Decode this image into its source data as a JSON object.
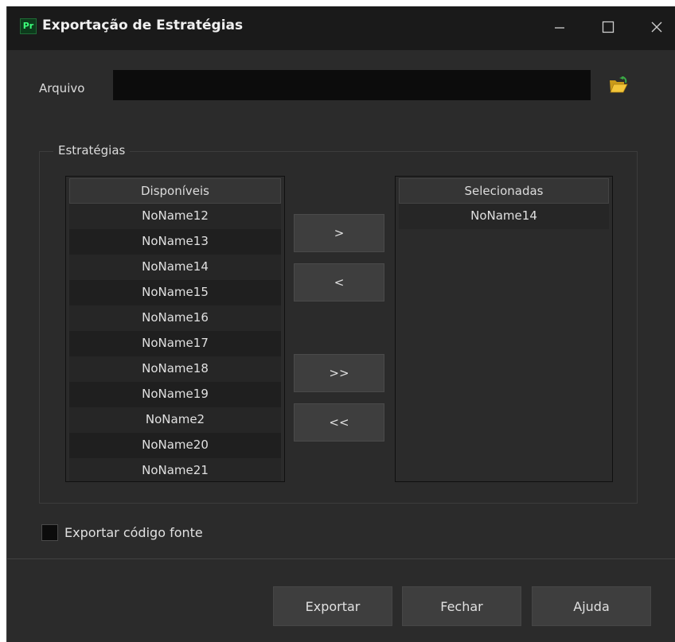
{
  "window": {
    "app_icon_text": "Pr",
    "title": "Exportação de Estratégias",
    "controls": {
      "minimize_icon": "minimize-icon",
      "maximize_icon": "maximize-icon",
      "close_icon": "close-icon"
    }
  },
  "arquivo": {
    "label": "Arquivo",
    "value": "",
    "placeholder": "",
    "browse_icon": "open-folder-icon"
  },
  "estrategias": {
    "group_title": "Estratégias",
    "disponiveis": {
      "header": "Disponíveis",
      "items": [
        "NoName12",
        "NoName13",
        "NoName14",
        "NoName15",
        "NoName16",
        "NoName17",
        "NoName18",
        "NoName19",
        "NoName2",
        "NoName20",
        "NoName21"
      ]
    },
    "selecionadas": {
      "header": "Selecionadas",
      "items": [
        "NoName14"
      ]
    },
    "buttons": {
      "add_one": ">",
      "remove_one": "<",
      "add_all": ">>",
      "remove_all": "<<"
    }
  },
  "options": {
    "export_source_label": "Exportar código fonte",
    "export_source_checked": false
  },
  "footer": {
    "export_label": "Exportar",
    "close_label": "Fechar",
    "help_label": "Ajuda"
  },
  "colors": {
    "window_bg": "#2b2b2b",
    "titlebar_bg": "#1a1a1a",
    "input_bg": "#0c0c0c",
    "button_bg": "#3e3e3e",
    "app_icon_accent": "#3cff7a",
    "folder_icon": "#f0c030"
  }
}
